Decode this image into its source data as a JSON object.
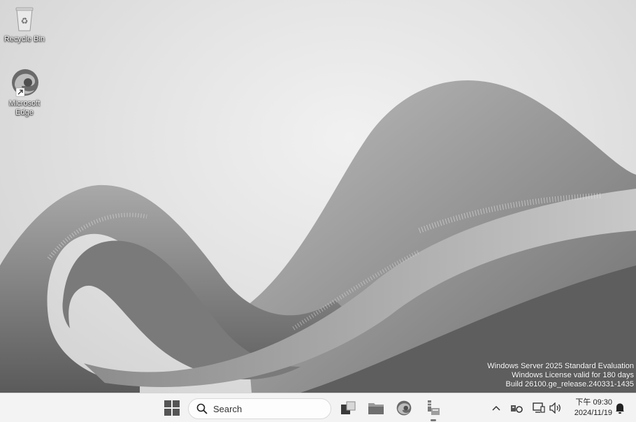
{
  "desktop": {
    "icons": [
      {
        "label": "Recycle Bin",
        "icon": "recycle-bin-icon"
      },
      {
        "label": "Microsoft Edge",
        "icon": "edge-icon"
      }
    ],
    "watermark": {
      "line1": "Windows Server 2025 Standard Evaluation",
      "line2": "Windows License valid for 180 days",
      "line3": "Build 26100.ge_release.240331-1435"
    }
  },
  "taskbar": {
    "start_icon": "windows-start-icon",
    "search_placeholder": "Search",
    "apps": [
      {
        "name": "task-view",
        "icon": "task-view-icon"
      },
      {
        "name": "file-explorer",
        "icon": "folder-icon"
      },
      {
        "name": "edge",
        "icon": "edge-icon"
      },
      {
        "name": "server-manager",
        "icon": "server-manager-icon",
        "running": true
      }
    ],
    "tray": {
      "icons": [
        "chevron-up-icon",
        "security-icon",
        "network-icon",
        "volume-icon",
        "notification-bell-icon"
      ],
      "time": "下午 09:30",
      "date": "2024/11/19"
    }
  }
}
